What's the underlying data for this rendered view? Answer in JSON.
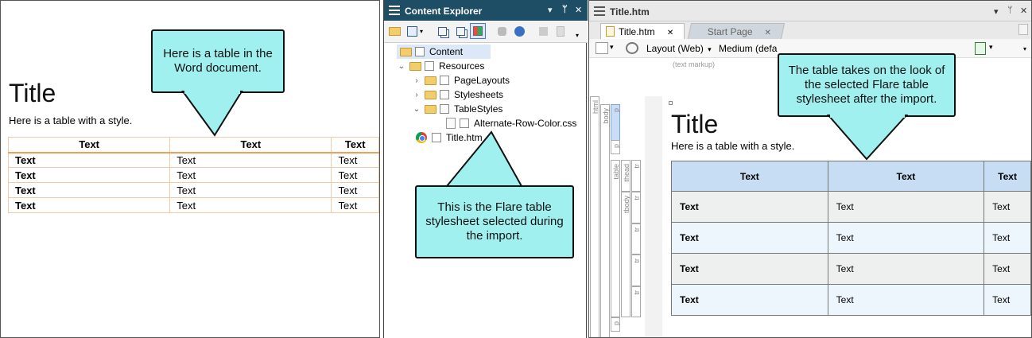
{
  "word": {
    "title": "Title",
    "subtitle": "Here is a table with a style.",
    "table": {
      "headers": [
        "Text",
        "Text",
        "Text"
      ],
      "rows": [
        [
          "Text",
          "Text",
          "Text"
        ],
        [
          "Text",
          "Text",
          "Text"
        ],
        [
          "Text",
          "Text",
          "Text"
        ],
        [
          "Text",
          "Text",
          "Text"
        ]
      ]
    }
  },
  "callouts": {
    "word": "Here is a table in the Word document.",
    "stylesheet": "This is the Flare table stylesheet selected during the import.",
    "editor": "The table takes on the look of the selected Flare table stylesheet after the import."
  },
  "content_explorer": {
    "title": "Content Explorer",
    "controls": {
      "dropdown": "▾",
      "pin": "ᛘ",
      "close": "✕"
    },
    "tree": [
      {
        "label": "Content",
        "level": 0,
        "chevron": "",
        "icon": "folder"
      },
      {
        "label": "Resources",
        "level": 1,
        "chevron": "⌄",
        "icon": "folder"
      },
      {
        "label": "PageLayouts",
        "level": 2,
        "chevron": "›",
        "icon": "folder"
      },
      {
        "label": "Stylesheets",
        "level": 2,
        "chevron": "›",
        "icon": "folder"
      },
      {
        "label": "TableStyles",
        "level": 2,
        "chevron": "⌄",
        "icon": "folder"
      },
      {
        "label": "Alternate-Row-Color.css",
        "level": 3,
        "chevron": "",
        "icon": "css-file"
      },
      {
        "label": "Title.htm",
        "level": 1,
        "chevron": "",
        "icon": "chrome"
      }
    ]
  },
  "editor": {
    "window_title": "Title.htm",
    "tabs": [
      {
        "label": "Title.htm",
        "close": "✕"
      },
      {
        "label": "Start Page",
        "close": "✕"
      }
    ],
    "toolbar": {
      "layout": "Layout (Web)",
      "medium": "Medium (defa",
      "caret": "▾"
    },
    "markup_label": "(text markup)",
    "structure_bars": {
      "html": "html",
      "body": "body",
      "p1": "p",
      "p2": "p",
      "p3": "p",
      "table": "table",
      "thead": "thead",
      "tbody": "tbody",
      "tr": "tr"
    },
    "doc_title": "Title",
    "doc_subtitle": "Here is a table with a style.",
    "table": {
      "headers": [
        "Text",
        "Text",
        "Text"
      ],
      "rows": [
        [
          "Text",
          "Text",
          "Text"
        ],
        [
          "Text",
          "Text",
          "Text"
        ],
        [
          "Text",
          "Text",
          "Text"
        ],
        [
          "Text",
          "Text",
          "Text"
        ]
      ]
    }
  }
}
